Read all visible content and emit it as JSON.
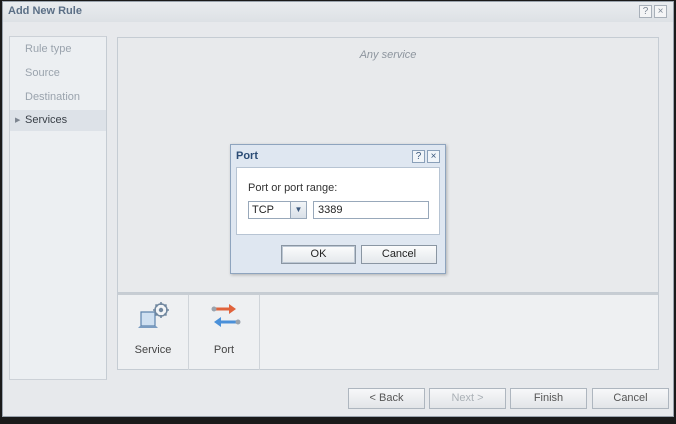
{
  "window": {
    "title": "Add New Rule",
    "help_glyph": "?",
    "close_glyph": "×"
  },
  "nav": {
    "items": [
      {
        "label": "Rule type",
        "active": false
      },
      {
        "label": "Source",
        "active": false
      },
      {
        "label": "Destination",
        "active": false
      },
      {
        "label": "Services",
        "active": true
      }
    ]
  },
  "main": {
    "header": "Any service"
  },
  "tiles": [
    {
      "label": "Service",
      "icon": "service-gear-icon"
    },
    {
      "label": "Port",
      "icon": "port-arrows-icon"
    }
  ],
  "footer": {
    "back_label": "< Back",
    "next_label": "Next >",
    "finish_label": "Finish",
    "cancel_label": "Cancel"
  },
  "dialog": {
    "title": "Port",
    "help_glyph": "?",
    "close_glyph": "×",
    "field_label": "Port or port range:",
    "protocol_value": "TCP",
    "port_value": "3389",
    "ok_label": "OK",
    "cancel_label": "Cancel"
  },
  "colors": {
    "title_text": "#5b6f86",
    "dialog_title": "#2b4c75",
    "port_arrow_orange": "#e0633c",
    "port_arrow_blue": "#4a90d9"
  }
}
